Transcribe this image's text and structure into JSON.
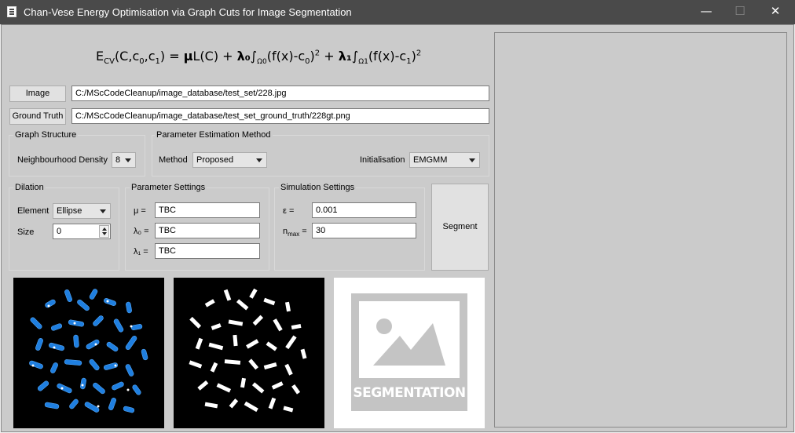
{
  "window": {
    "title": "Chan-Vese Energy Optimisation via Graph Cuts for Image Segmentation",
    "minimize": "—",
    "maximize": "☐",
    "close": "✕"
  },
  "formula": {
    "lhs": "E",
    "lhs_sub": "CV",
    "args": "(C,c",
    "args_sub0": "0",
    "args_mid": ",c",
    "args_sub1": "1",
    "args_end": ") = ",
    "mu": "μ",
    "length": "L(C) + ",
    "lambda0": "λ₀",
    "int0": "∫",
    "omega0": "Ω0",
    "term0": "(f(x)-c",
    "term0_sub": "0",
    "term0_end": ")",
    "sq0": "2",
    "plus": " + ",
    "lambda1": "λ₁",
    "int1": "∫",
    "omega1": "Ω1",
    "term1": "(f(x)-c",
    "term1_sub": "1",
    "term1_end": ")",
    "sq1": "2"
  },
  "files": {
    "image_button": "Image",
    "image_path": "C:/MScCodeCleanup/image_database/test_set/228.jpg",
    "ground_truth_button": "Ground Truth",
    "ground_truth_path": "C:/MScCodeCleanup/image_database/test_set_ground_truth/228gt.png"
  },
  "graph_structure": {
    "title": "Graph Structure",
    "density_label": "Neighbourhood Density",
    "density_value": "8"
  },
  "param_estimation": {
    "title": "Parameter Estimation Method",
    "method_label": "Method",
    "method_value": "Proposed",
    "init_label": "Initialisation",
    "init_value": "EMGMM"
  },
  "dilation": {
    "title": "Dilation",
    "element_label": "Element",
    "element_value": "Ellipse",
    "size_label": "Size",
    "size_value": "0"
  },
  "parameter_settings": {
    "title": "Parameter Settings",
    "mu_label": "μ =",
    "mu_value": "TBC",
    "lambda0_label": "λ₀ =",
    "lambda0_value": "TBC",
    "lambda1_label": "λ₁ =",
    "lambda1_value": "TBC"
  },
  "simulation_settings": {
    "title": "Simulation Settings",
    "eps_label": "ε =",
    "eps_value": "0.001",
    "nmax_label": "n",
    "nmax_sub": "max",
    "nmax_eq": " =",
    "nmax_value": "30"
  },
  "segment_button": "Segment",
  "segmentation_placeholder_label": "SEGMENTATION",
  "colors": {
    "titlebar": "#4a4a4a",
    "background": "#cbcbcb",
    "chromosome_blue": "#1f7fe0",
    "placeholder_grey": "#c4c4c4"
  }
}
